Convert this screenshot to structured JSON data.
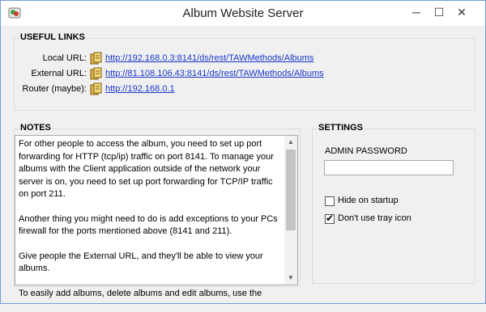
{
  "window": {
    "title": "Album Website Server",
    "minimize_glyph": "─",
    "maximize_glyph": "☐",
    "close_glyph": "✕"
  },
  "useful_links": {
    "heading": "USEFUL LINKS",
    "rows": [
      {
        "label": "Local URL:",
        "url": "http://192.168.0.3:8141/ds/rest/TAWMethods/Albums"
      },
      {
        "label": "External URL:",
        "url": "http://81.108.106.43:8141/ds/rest/TAWMethods/Albums"
      },
      {
        "label": "Router (maybe):",
        "url": "http://192.168.0.1"
      }
    ]
  },
  "notes": {
    "heading": "NOTES",
    "paragraphs": [
      "For other people to access the album, you need to set up port forwarding for HTTP (tcp/ip) traffic on port 8141. To manage your albums with the Client application outside of the network your server is on, you need to set up port forwarding for TCP/IP traffic on port 211.",
      "Another thing you might need to do is add exceptions to your PCs firewall for the ports mentioned above (8141 and 211).",
      "Give people the External URL, and they'll be able to view your albums.",
      "To easily add albums, delete albums and edit albums, use the"
    ]
  },
  "settings": {
    "heading": "SETTINGS",
    "admin_password_label": "ADMIN PASSWORD",
    "admin_password_value": "",
    "hide_on_startup": {
      "label": "Hide on startup",
      "checked": false
    },
    "dont_use_tray_icon": {
      "label": "Don't use tray icon",
      "checked": true
    }
  },
  "colors": {
    "link": "#1a37c9",
    "window_border": "#6fa0d8",
    "background": "#f0f0f0"
  }
}
